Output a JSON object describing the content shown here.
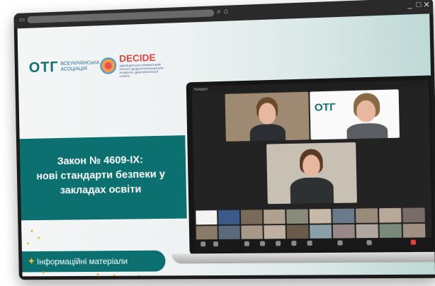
{
  "window": {
    "minimize_icon": "minimize-icon",
    "maximize_icon": "maximize-icon",
    "close_icon": "close-icon"
  },
  "address_bar": {
    "search_icon": "search-icon",
    "home_icon": "home-icon"
  },
  "logos": {
    "otg_text": "ОТГ",
    "otg_subtitle": "ВСЕУКРАЇНСЬКА АСОЦІАЦІЯ",
    "decide_text": "DECIDE",
    "decide_subtitle": "ШВЕЙЦАРСЬКО-УКРАЇНСЬКИЙ ПРОЄКТ ДЕЦЕНТРАЛІЗАЦІЯ ДЛЯ РОЗВИТКУ ДЕМОКРАТИЧНОЇ ОСВІТИ"
  },
  "title": {
    "line1": "Закон № 4609-IX:",
    "line2": "нові стандарти безпеки у",
    "line3": "закладах освіти"
  },
  "cta": {
    "label": "Інформаційні матеріали",
    "icon": "cursor-click-icon"
  },
  "zoom": {
    "top_left": "Галерея",
    "otg_card": "ОТГ",
    "colors": {
      "accent": "#0c6f70",
      "accent2": "#0f6f74",
      "dots": "#f0a838"
    }
  }
}
